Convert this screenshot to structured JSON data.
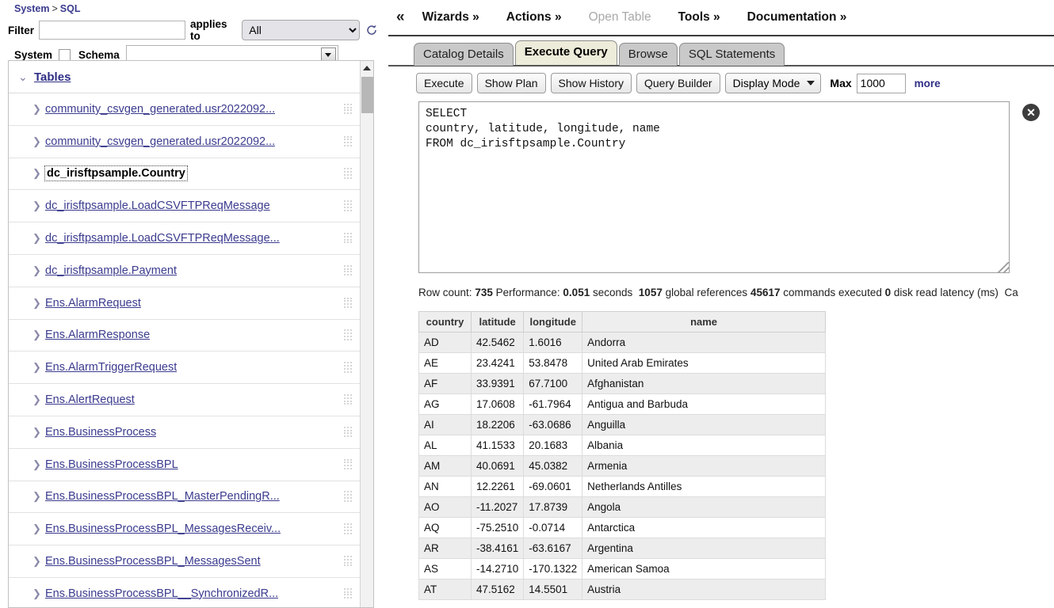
{
  "breadcrumb": {
    "root": "System",
    "separator": ">",
    "current": "SQL"
  },
  "filter_bar": {
    "filter_label": "Filter",
    "filter_value": "",
    "filter_placeholder": "",
    "applies_to_label": "applies to",
    "applies_to_value": "All",
    "applies_to_options": [
      "All"
    ],
    "refresh_icon": "refresh-icon"
  },
  "schema_bar": {
    "system_label": "System",
    "system_checked": false,
    "schema_label": "Schema",
    "schema_value": "",
    "schema_options": []
  },
  "sidebar": {
    "header": {
      "label": "Tables",
      "expanded": true,
      "chevron_icon": "chevron-down-icon"
    },
    "items": [
      {
        "label": "community_csvgen_generated.usr2022092...",
        "selected": false
      },
      {
        "label": "community_csvgen_generated.usr2022092...",
        "selected": false
      },
      {
        "label": "dc_irisftpsample.Country",
        "selected": true
      },
      {
        "label": "dc_irisftpsample.LoadCSVFTPReqMessage",
        "selected": false
      },
      {
        "label": "dc_irisftpsample.LoadCSVFTPReqMessage...",
        "selected": false
      },
      {
        "label": "dc_irisftpsample.Payment",
        "selected": false
      },
      {
        "label": "Ens.AlarmRequest",
        "selected": false
      },
      {
        "label": "Ens.AlarmResponse",
        "selected": false
      },
      {
        "label": "Ens.AlarmTriggerRequest",
        "selected": false
      },
      {
        "label": "Ens.AlertRequest",
        "selected": false
      },
      {
        "label": "Ens.BusinessProcess",
        "selected": false
      },
      {
        "label": "Ens.BusinessProcessBPL",
        "selected": false
      },
      {
        "label": "Ens.BusinessProcessBPL_MasterPendingR...",
        "selected": false
      },
      {
        "label": "Ens.BusinessProcessBPL_MessagesReceiv...",
        "selected": false
      },
      {
        "label": "Ens.BusinessProcessBPL_MessagesSent",
        "selected": false
      },
      {
        "label": "Ens.BusinessProcessBPL__SynchronizedR...",
        "selected": false
      }
    ]
  },
  "topnav": {
    "collapse_icon": "«",
    "items": [
      {
        "label": "Wizards »",
        "disabled": false
      },
      {
        "label": "Actions »",
        "disabled": false
      },
      {
        "label": "Open Table",
        "disabled": true
      },
      {
        "label": "Tools »",
        "disabled": false
      },
      {
        "label": "Documentation »",
        "disabled": false
      }
    ]
  },
  "tabs": [
    {
      "label": "Catalog Details",
      "active": false
    },
    {
      "label": "Execute Query",
      "active": true
    },
    {
      "label": "Browse",
      "active": false
    },
    {
      "label": "SQL Statements",
      "active": false
    }
  ],
  "toolbar": {
    "execute_label": "Execute",
    "show_plan_label": "Show Plan",
    "show_history_label": "Show History",
    "query_builder_label": "Query Builder",
    "display_mode_label": "Display Mode",
    "display_mode_options": [
      "Display Mode"
    ],
    "max_label": "Max",
    "max_value": "1000",
    "more_label": "more"
  },
  "query": {
    "text": "SELECT\ncountry, latitude, longitude, name\nFROM dc_irisftpsample.Country",
    "close_icon": "close-icon",
    "resize_icon": "resize-grip-icon"
  },
  "status": {
    "row_count_label": "Row count:",
    "row_count_value": "735",
    "performance_label": "Performance:",
    "performance_value": "0.051",
    "seconds_label": "seconds",
    "global_refs_value": "1057",
    "global_refs_label": "global references",
    "commands_value": "45617",
    "commands_label": "commands executed",
    "disk_value": "0",
    "disk_label": "disk read latency (ms)",
    "truncated_tail": "Ca"
  },
  "results": {
    "columns": [
      "country",
      "latitude",
      "longitude",
      "name"
    ],
    "rows": [
      [
        "AD",
        "42.5462",
        "1.6016",
        "Andorra"
      ],
      [
        "AE",
        "23.4241",
        "53.8478",
        "United Arab Emirates"
      ],
      [
        "AF",
        "33.9391",
        "67.7100",
        "Afghanistan"
      ],
      [
        "AG",
        "17.0608",
        "-61.7964",
        "Antigua and Barbuda"
      ],
      [
        "AI",
        "18.2206",
        "-63.0686",
        "Anguilla"
      ],
      [
        "AL",
        "41.1533",
        "20.1683",
        "Albania"
      ],
      [
        "AM",
        "40.0691",
        "45.0382",
        "Armenia"
      ],
      [
        "AN",
        "12.2261",
        "-69.0601",
        "Netherlands Antilles"
      ],
      [
        "AO",
        "-11.2027",
        "17.8739",
        "Angola"
      ],
      [
        "AQ",
        "-75.2510",
        "-0.0714",
        "Antarctica"
      ],
      [
        "AR",
        "-38.4161",
        "-63.6167",
        "Argentina"
      ],
      [
        "AS",
        "-14.2710",
        "-170.1322",
        "American Samoa"
      ],
      [
        "AT",
        "47.5162",
        "14.5501",
        "Austria"
      ]
    ]
  },
  "colors": {
    "link": "#3b3b8f",
    "active_tab_bg": "#edebd9",
    "tab_bg": "#c9c9c9",
    "row_alt_bg": "#ededed",
    "header_bg": "#eeeeee"
  }
}
